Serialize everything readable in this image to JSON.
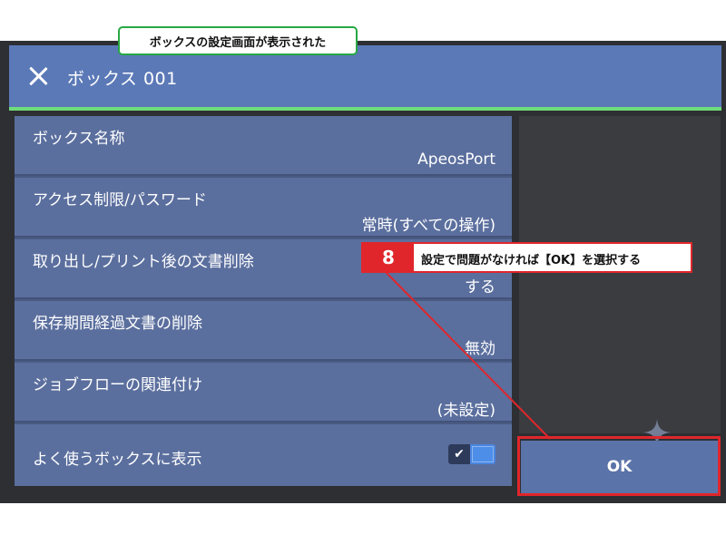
{
  "header": {
    "title": "ボックス 001"
  },
  "settings": [
    {
      "label": "ボックス名称",
      "value": "ApeosPort"
    },
    {
      "label": "アクセス制限/パスワード",
      "value": "常時(すべての操作)"
    },
    {
      "label": "取り出し/プリント後の文書削除",
      "value": "する"
    },
    {
      "label": "保存期間経過文書の削除",
      "value": "無効"
    },
    {
      "label": "ジョブフローの関連付け",
      "value": "(未設定)"
    },
    {
      "label": "よく使うボックスに表示",
      "value": ""
    }
  ],
  "toggle": {
    "checked": true,
    "check_glyph": "✔"
  },
  "ok_button": {
    "label": "OK"
  },
  "annotations": {
    "top_note": "ボックスの設定画面が表示された",
    "step_number": "8",
    "step_text": "設定で問題がなければ【OK】を選択する"
  },
  "colors": {
    "header_bg": "#5b79b7",
    "accent_line": "#6fdc7a",
    "row_bg": "#5b6f9e",
    "highlight_red": "#e0262b",
    "note_green": "#27a843"
  }
}
